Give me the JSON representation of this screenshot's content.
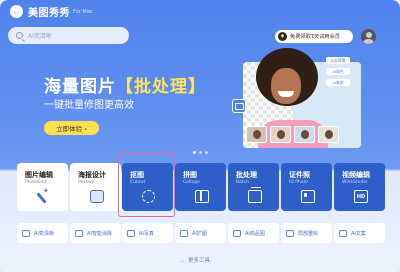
{
  "app": {
    "name": "美图秀秀",
    "edition": "For Mac",
    "logo_glyph": "◡"
  },
  "search": {
    "placeholder": "AI变清晰"
  },
  "trial": {
    "label": "免费领取7天试用会员",
    "icon_glyph": "♦"
  },
  "hero": {
    "title_prefix": "海量图片",
    "title_highlight": "【批处理】",
    "subtitle": "一键批量修图更高效",
    "cta": "立即体验 ›",
    "chips": [
      "AI去背景",
      "AI调色",
      "AI美颜"
    ]
  },
  "tools": [
    {
      "title": "图片编辑",
      "sub": "PhotoEdit",
      "style": "light",
      "icon": "magic-wand-icon"
    },
    {
      "title": "海报设计",
      "sub": "Posters",
      "style": "light",
      "icon": "poster-icon"
    },
    {
      "title": "抠图",
      "sub": "Cutout",
      "style": "dark",
      "icon": "cutout-icon"
    },
    {
      "title": "拼图",
      "sub": "Collage",
      "style": "dark",
      "icon": "collage-icon"
    },
    {
      "title": "批处理",
      "sub": "Batch",
      "style": "dark",
      "icon": "batch-icon"
    },
    {
      "title": "证件照",
      "sub": "ID Photo",
      "style": "dark",
      "icon": "id-photo-icon"
    },
    {
      "title": "视频编辑",
      "sub": "WinkStudio",
      "style": "dark",
      "icon": "video-icon",
      "icon_text": "HD"
    }
  ],
  "mini_tools": [
    "AI变清晰",
    "AI智能消除",
    "AI写真",
    "AI扩图",
    "AI商品图",
    "局部重绘",
    "AI文案"
  ],
  "more": {
    "label": "更多工具",
    "chevron": "︿"
  },
  "colors": {
    "primary": "#4f82ec",
    "dark_card": "#2d5fc8",
    "highlight": "#ffe14d",
    "selection": "#e06b8e"
  }
}
